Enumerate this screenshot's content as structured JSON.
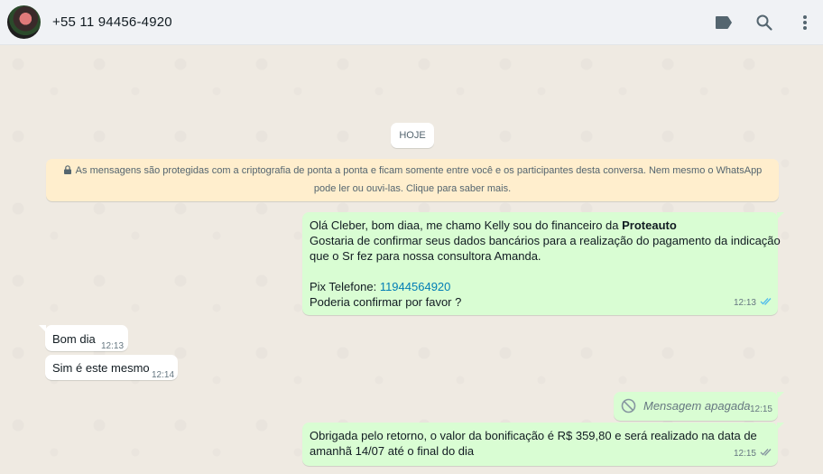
{
  "header": {
    "contact_name": "+55 11 94456-4920",
    "icons": [
      "label-icon",
      "search-icon",
      "menu-icon"
    ]
  },
  "chat": {
    "date_divider": "HOJE",
    "encryption_notice": {
      "line1": "As mensagens são protegidas com a criptografia de ponta a ponta e ficam somente entre você e os participantes desta conversa. Nem mesmo o WhatsApp",
      "line2": "pode ler ou ouvi-las. Clique para saber mais."
    },
    "messages": [
      {
        "direction": "outgoing",
        "line1_prefix": "Olá Cleber, bom diaa, me chamo Kelly  sou do financeiro da ",
        "line1_bold": "Proteauto",
        "line2": "Gostaria de confirmar seus dados bancários para a realização do pagamento da indicação",
        "line3": "que o Sr fez para nossa consultora Amanda.",
        "pix_label": "Pix Telefone:  ",
        "pix_number": "11944564920",
        "line5": "Poderia confirmar por favor ?",
        "time": "12:13"
      },
      {
        "direction": "incoming",
        "text": "Bom dia",
        "time": "12:13"
      },
      {
        "direction": "incoming",
        "text": "Sim é este mesmo",
        "time": "12:14"
      },
      {
        "direction": "outgoing",
        "deleted": true,
        "text": "Mensagem apagada",
        "time": "12:15"
      },
      {
        "direction": "outgoing",
        "line1": "Obrigada pelo retorno, o valor da bonificação é R$ 359,80 e será realizado na data de",
        "line2": "amanhã 14/07 até o final do dia",
        "time": "12:15"
      }
    ]
  },
  "colors": {
    "chat_bg": "#efeae2",
    "outgoing_bubble": "#d9fdd3",
    "incoming_bubble": "#ffffff",
    "encryption_bg": "#ffeecd",
    "header_bg": "#f0f2f5",
    "read_ticks": "#53bdeb",
    "link": "#027eb5"
  }
}
